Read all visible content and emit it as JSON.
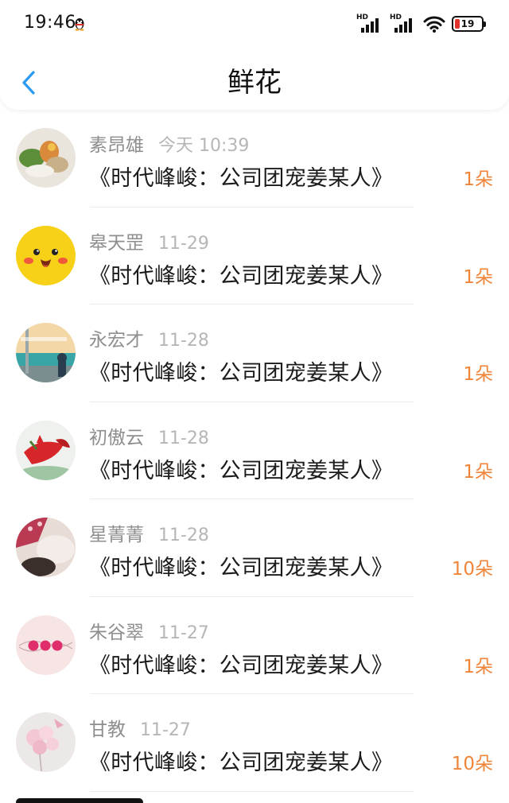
{
  "status_bar": {
    "time": "19:46",
    "signal_label_1": "HD",
    "signal_label_2": "HD",
    "battery": "19",
    "battery_color": "#e0312b"
  },
  "header": {
    "title": "鲜花",
    "back_icon": "chevron-left-icon",
    "accent_color": "#2b9af3"
  },
  "flowers": [
    {
      "name": "素昂雄",
      "date": "今天 10:39",
      "book": "《时代峰峻：公司团宠姜某人》",
      "amount": "1朵"
    },
    {
      "name": "皋天罡",
      "date": "11-29",
      "book": "《时代峰峻：公司团宠姜某人》",
      "amount": "1朵"
    },
    {
      "name": "永宏才",
      "date": "11-28",
      "book": "《时代峰峻：公司团宠姜某人》",
      "amount": "1朵"
    },
    {
      "name": "初傲云",
      "date": "11-28",
      "book": "《时代峰峻：公司团宠姜某人》",
      "amount": "1朵"
    },
    {
      "name": "星菁菁",
      "date": "11-28",
      "book": "《时代峰峻：公司团宠姜某人》",
      "amount": "10朵"
    },
    {
      "name": "朱谷翠",
      "date": "11-27",
      "book": "《时代峰峻：公司团宠姜某人》",
      "amount": "1朵"
    },
    {
      "name": "甘教",
      "date": "11-27",
      "book": "《时代峰峻：公司团宠姜某人》",
      "amount": "10朵"
    }
  ],
  "amount_color": "#f08438"
}
